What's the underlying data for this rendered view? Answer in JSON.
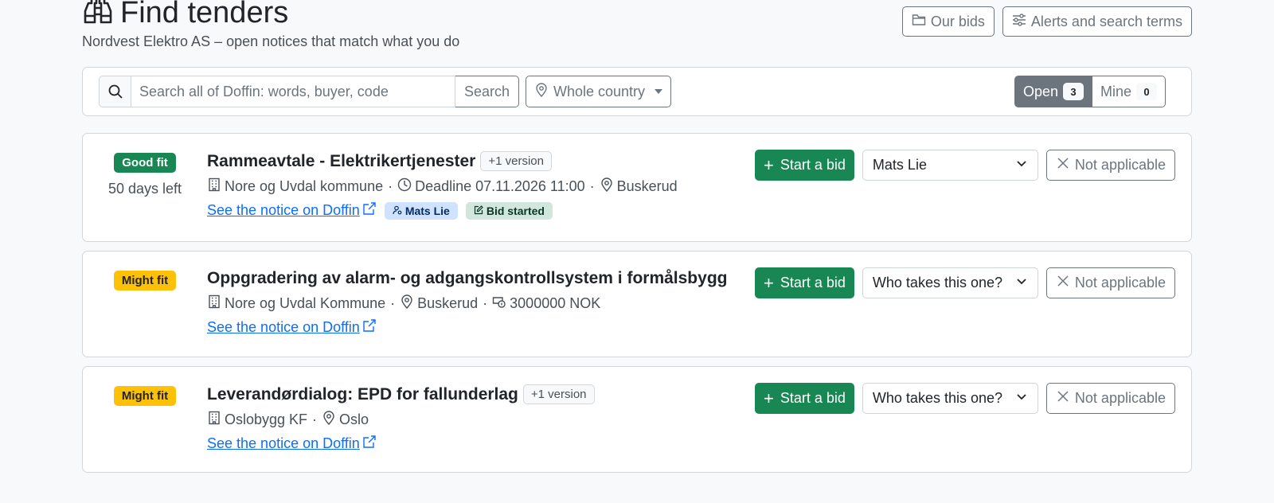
{
  "header": {
    "title": "Find tenders",
    "title_icon": "binoculars-icon",
    "subtitle": "Nordvest Elektro AS – open notices that match what you do",
    "our_bids_label": "Our bids",
    "alerts_label": "Alerts and search terms"
  },
  "search": {
    "placeholder": "Search all of Doffin: words, buyer, code",
    "value": "",
    "button_label": "Search",
    "region_value": "Whole country"
  },
  "tabs": {
    "open_label": "Open",
    "open_count": "3",
    "mine_label": "Mine",
    "mine_count": "0"
  },
  "tenders": [
    {
      "fit": "Good fit",
      "fit_kind": "good",
      "days_left": "50 days left",
      "title": "Rammeavtale - Elektrikertjenester",
      "version": "+1 version",
      "buyer": "Nore og Uvdal kommune",
      "deadline": "Deadline 07.11.2026 11:00",
      "region": "Buskerud",
      "link_label": "See the notice on Doffin",
      "assignee_tag": "Mats Lie",
      "status_tag": "Bid started",
      "start_label": "Start a bid",
      "assign_value": "Mats Lie",
      "na_label": "Not applicable"
    },
    {
      "fit": "Might fit",
      "fit_kind": "might",
      "title": "Oppgradering av alarm- og adgangskontrollsystem i formålsbygg",
      "buyer": "Nore og Uvdal Kommune",
      "region": "Buskerud",
      "value": "3000000 NOK",
      "link_label": "See the notice on Doffin",
      "start_label": "Start a bid",
      "assign_value": "Who takes this one?",
      "na_label": "Not applicable"
    },
    {
      "fit": "Might fit",
      "fit_kind": "might",
      "title": "Leverandørdialog: EPD for fallunderlag",
      "version": "+1 version",
      "buyer": "Oslobygg KF",
      "region": "Oslo",
      "link_label": "See the notice on Doffin",
      "start_label": "Start a bid",
      "assign_value": "Who takes this one?",
      "na_label": "Not applicable"
    }
  ],
  "colors": {
    "success": "#198754",
    "warning": "#ffc107",
    "secondary": "#6c757d",
    "link": "#0d6efd"
  }
}
